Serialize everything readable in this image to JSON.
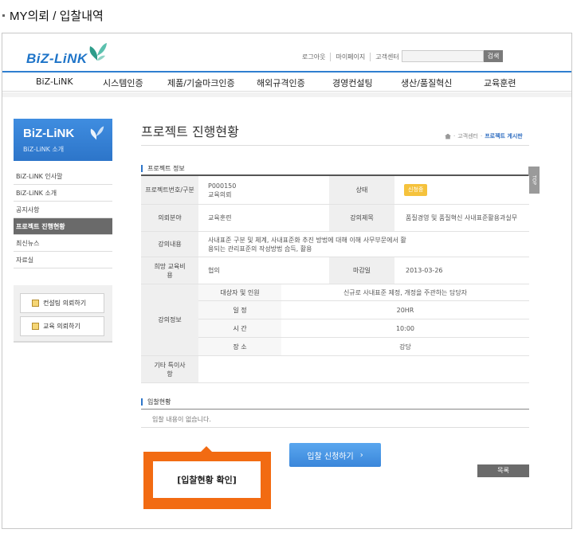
{
  "page_caption": "MY의뢰 / 입찰내역",
  "header": {
    "logo_text": "BiZ-LiNK",
    "util_links": [
      "로그아웃",
      "마이페이지",
      "고객센터"
    ],
    "search_button": "검색",
    "search_placeholder": "",
    "gnb": [
      "BiZ-LiNK",
      "시스템인증",
      "제품/기술마크인증",
      "해외규격인증",
      "경영컨설팅",
      "생산/품질혁신",
      "교육훈련"
    ]
  },
  "sidebar": {
    "title": "BiZ-LiNK",
    "subtitle": "BiZ-LiNK 소개",
    "items": [
      "BiZ-LiNK 인사말",
      "BiZ-LiNK 소개",
      "공지사항",
      "프로젝트 진행현황",
      "최신뉴스",
      "자료실"
    ],
    "active_index": 3,
    "quick_buttons": [
      "컨설팅 의뢰하기",
      "교육 의뢰하기"
    ]
  },
  "content": {
    "title": "프로젝트 진행현황",
    "breadcrumb": [
      "고객센터",
      "프로젝트 게시판"
    ],
    "project_section_title": "프로젝트 정보",
    "top_label": "TOP",
    "labels": {
      "project_no": "프로젝트번호/구분",
      "status": "상태",
      "request_field": "의뢰분야",
      "lecture_title": "강의제목",
      "lecture_content": "강의내용",
      "desired_cost": "희망 교육비용",
      "deadline": "마감일",
      "lecture_info": "강의정보",
      "target": "대상자 및 인원",
      "schedule": "일 정",
      "time": "시 간",
      "place": "장 소",
      "etc": "기타 특이사항"
    },
    "values": {
      "project_no": "P000150",
      "category": "교육의뢰",
      "status": "신청중",
      "request_field": "교육훈련",
      "lecture_title": "품질경영 및 품질혁신 사내표준활용과실무",
      "lecture_content": "사내표준 구분 및 체계, 사내표준화 추진 방법에 대해 이해 사무부문에서 활용되는 관리표준의 작성방법 습득, 활용",
      "desired_cost": "협의",
      "deadline": "2013-03-26",
      "target": "신규로 사내표준 제정, 개정을 주관하는 담당자",
      "schedule": "20HR",
      "time": "10:00",
      "place": "강당",
      "etc": ""
    },
    "bid_section_title": "입찰현황",
    "bid_empty": "입찰 내용이 없습니다.",
    "apply_button": "입찰 신청하기",
    "list_button": "목록",
    "callout_text": "[입찰현황 확인]"
  }
}
